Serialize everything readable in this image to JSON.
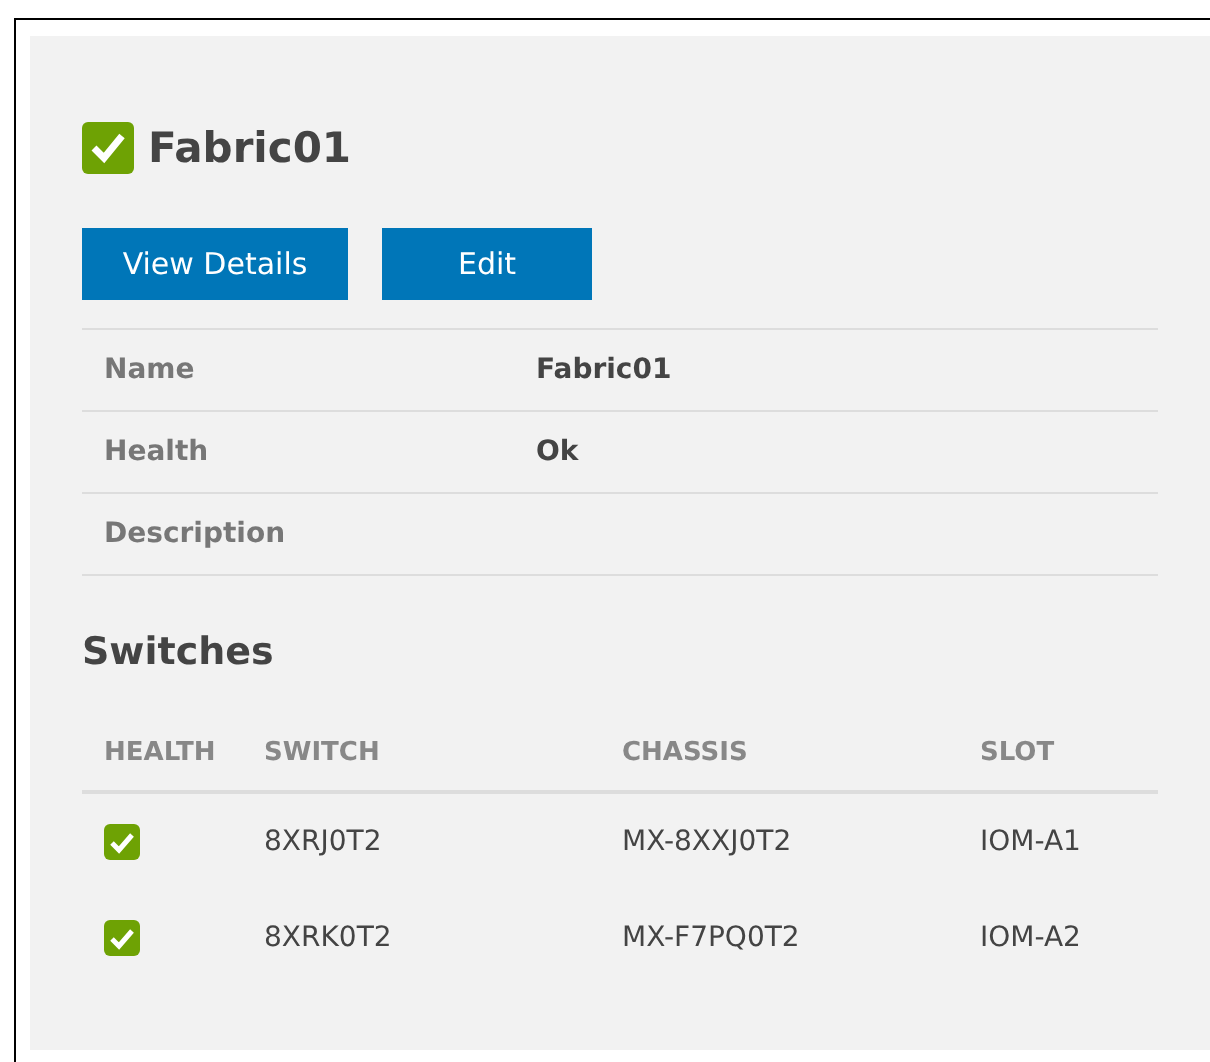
{
  "title": {
    "text": "Fabric01",
    "healthy": true
  },
  "buttons": [
    "View Details",
    "Edit"
  ],
  "properties": [
    {
      "label": "Name",
      "value": "Fabric01"
    },
    {
      "label": "Health",
      "value": "Ok"
    },
    {
      "label": "Description"
    }
  ],
  "switches": {
    "heading": "Switches",
    "columns": [
      "HEALTH",
      "SWITCH",
      "CHASSIS",
      "SLOT"
    ],
    "rows": [
      {
        "healthy": true,
        "switch": "8XRJ0T2",
        "chassis": "MX-8XXJ0T2",
        "slot": "IOM-A1"
      },
      {
        "healthy": true,
        "switch": "8XRK0T2",
        "chassis": "MX-F7PQ0T2",
        "slot": "IOM-A2"
      }
    ]
  }
}
